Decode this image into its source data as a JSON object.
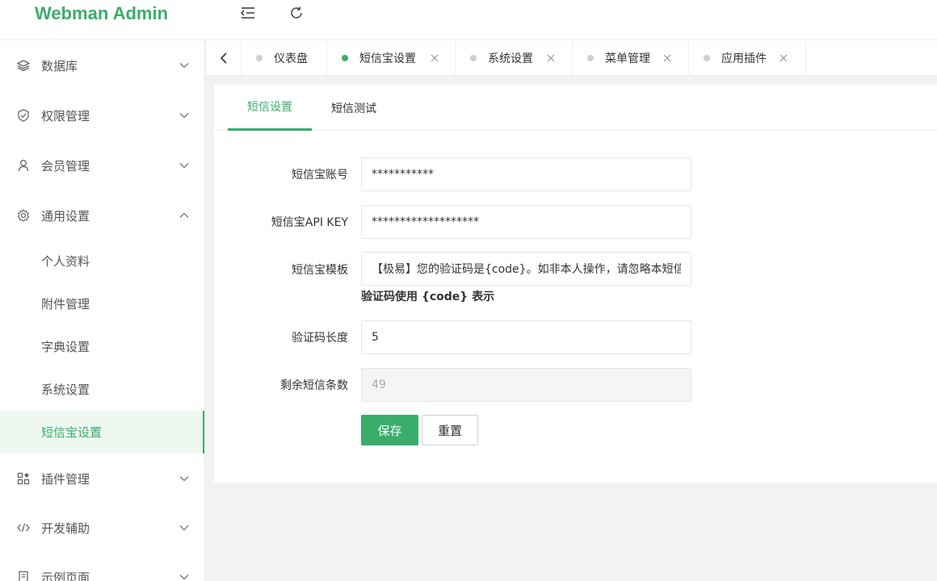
{
  "app": {
    "title": "Webman Admin"
  },
  "colors": {
    "accent": "#3aad6b",
    "inactive_dot": "#cfcfcf"
  },
  "header": {
    "icons": [
      "menu-fold-icon",
      "refresh-icon"
    ]
  },
  "sidebar": {
    "items": [
      {
        "label": "数据库",
        "icon": "database-icon",
        "expanded": false
      },
      {
        "label": "权限管理",
        "icon": "shield-icon",
        "expanded": false
      },
      {
        "label": "会员管理",
        "icon": "user-icon",
        "expanded": false
      },
      {
        "label": "通用设置",
        "icon": "gear-icon",
        "expanded": true,
        "children": [
          {
            "label": "个人资料"
          },
          {
            "label": "附件管理"
          },
          {
            "label": "字典设置"
          },
          {
            "label": "系统设置"
          },
          {
            "label": "短信宝设置",
            "active": true
          }
        ]
      },
      {
        "label": "插件管理",
        "icon": "plugin-icon",
        "expanded": false
      },
      {
        "label": "开发辅助",
        "icon": "code-icon",
        "expanded": false
      },
      {
        "label": "示例页面",
        "icon": "page-icon",
        "expanded": false
      }
    ]
  },
  "tabs": [
    {
      "label": "仪表盘",
      "closable": false
    },
    {
      "label": "短信宝设置",
      "closable": true,
      "active": true
    },
    {
      "label": "系统设置",
      "closable": true
    },
    {
      "label": "菜单管理",
      "closable": true
    },
    {
      "label": "应用插件",
      "closable": true
    }
  ],
  "subtabs": [
    {
      "label": "短信设置",
      "active": true
    },
    {
      "label": "短信测试"
    }
  ],
  "form": {
    "account_label": "短信宝账号",
    "account_value": "***********",
    "apikey_label": "短信宝API KEY",
    "apikey_value": "*******************",
    "template_label": "短信宝模板",
    "template_value": "【极易】您的验证码是{code}。如非本人操作，请忽略本短信",
    "template_hint": "验证码使用 {code} 表示",
    "codelen_label": "验证码长度",
    "codelen_value": "5",
    "remaining_label": "剩余短信条数",
    "remaining_value": "49",
    "save_label": "保存",
    "reset_label": "重置"
  }
}
